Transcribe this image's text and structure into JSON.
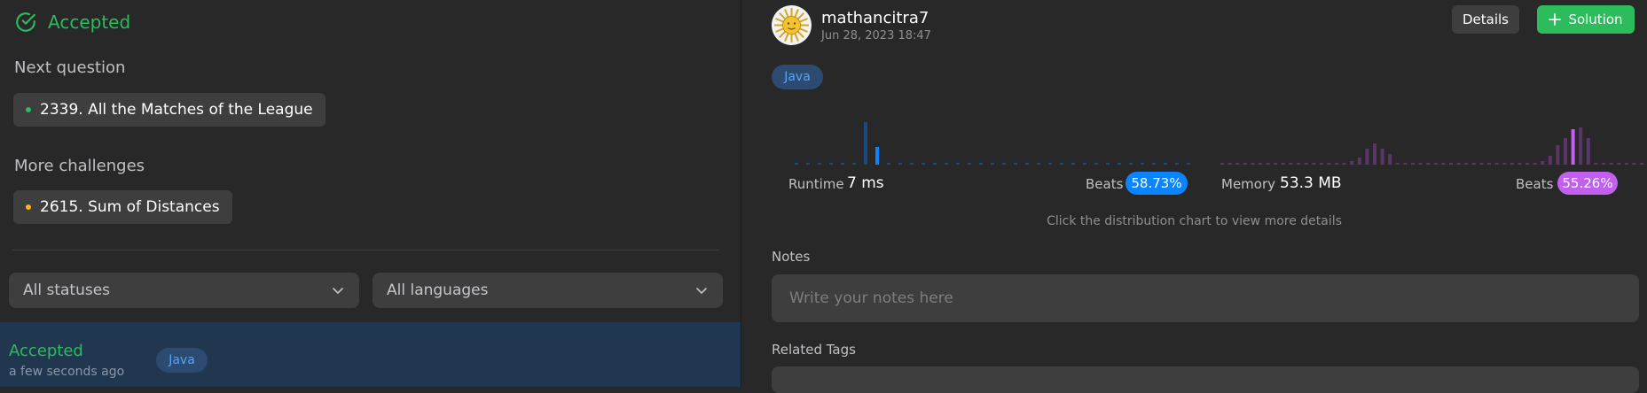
{
  "left": {
    "status_title": "Accepted",
    "next_question_label": "Next question",
    "next_question": "2339. All the Matches of the League",
    "more_challenges_label": "More challenges",
    "challenge": "2615. Sum of Distances",
    "filters": {
      "status": "All statuses",
      "language": "All languages"
    },
    "submission": {
      "status": "Accepted",
      "time": "a few seconds ago",
      "language": "Java"
    }
  },
  "right": {
    "username": "mathancitra7",
    "date": "Jun 28, 2023 18:47",
    "details_label": "Details",
    "solution_label": "Solution",
    "language": "Java",
    "runtime_label": "Runtime",
    "runtime_value": "7 ms",
    "runtime_beats_label": "Beats",
    "runtime_beats": "58.73%",
    "memory_label": "Memory",
    "memory_value": "53.3 MB",
    "memory_beats_label": "Beats",
    "memory_beats": "55.26%",
    "chart_hint": "Click the distribution chart to view more details",
    "notes_label": "Notes",
    "notes_placeholder": "Write your notes here",
    "related_tags_label": "Related Tags"
  },
  "colors": {
    "accepted": "#2cbb5d",
    "runtime_bar": "#1a4b80",
    "runtime_highlight": "#0a84ff",
    "memory_bar": "#5a3568",
    "memory_highlight": "#c160ef",
    "chip_dot_next": "#2cbb5d",
    "chip_dot_challenge": "#ffb800"
  },
  "icons": {
    "status": "check-circle-icon",
    "select": "chevron-down-icon",
    "solution": "plus-icon"
  }
}
